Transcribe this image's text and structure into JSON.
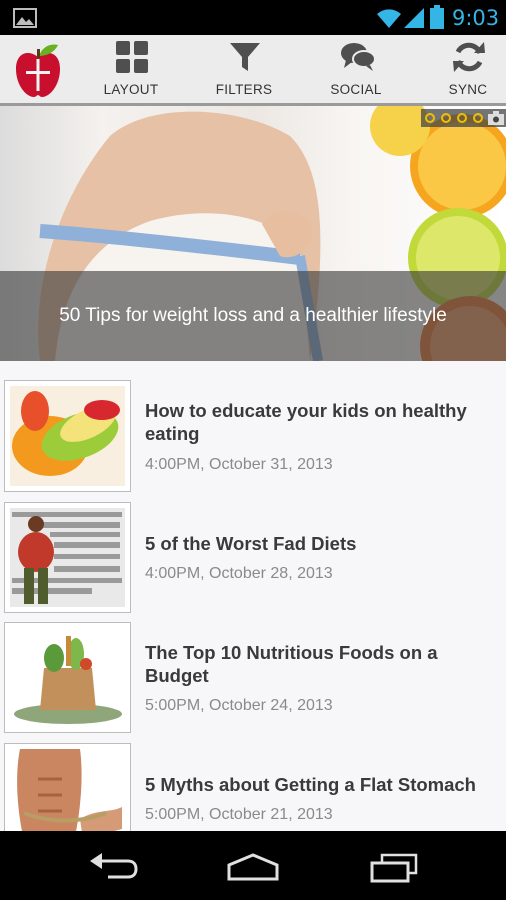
{
  "status_bar": {
    "time": "9:03",
    "icons": [
      "gallery-icon",
      "wifi-icon",
      "signal-icon",
      "battery-icon"
    ],
    "accent_color": "#33b5e5"
  },
  "action_bar": {
    "logo": "apple-logo-icon",
    "items": [
      {
        "label": "LAYOUT",
        "icon": "grid-icon"
      },
      {
        "label": "FILTERS",
        "icon": "funnel-icon"
      },
      {
        "label": "SOCIAL",
        "icon": "chat-bubbles-icon"
      },
      {
        "label": "SYNC",
        "icon": "sync-icon"
      }
    ]
  },
  "hero": {
    "caption": "50 Tips for weight loss and a healthier lifestyle",
    "pager_count": 4,
    "pager_indicator_icon": "camera-icon"
  },
  "articles": [
    {
      "title": "How to educate your kids on healthy eating",
      "date": "4:00PM, October 31, 2013"
    },
    {
      "title": "5 of the Worst Fad Diets",
      "date": "4:00PM, October 28, 2013"
    },
    {
      "title": "The Top 10 Nutritious Foods on a Budget",
      "date": "5:00PM, October 24, 2013"
    },
    {
      "title": "5 Myths about Getting a Flat Stomach",
      "date": "5:00PM, October 21, 2013"
    }
  ],
  "nav_bar": {
    "icons": [
      "back-icon",
      "home-icon",
      "recent-apps-icon"
    ]
  }
}
